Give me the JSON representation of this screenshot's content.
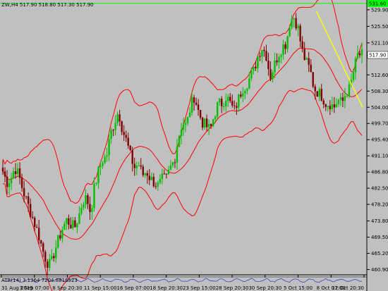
{
  "window": {
    "symbol_label": "ZW,H4",
    "ohlc": [
      "517.90",
      "518.80",
      "517.30",
      "517.90"
    ]
  },
  "indicator": {
    "label": "ATR(14) 3.1364  7204.8816523"
  },
  "colors": {
    "background": "#c0c0c0",
    "up_candle": "#00c000",
    "down_candle": "#800000",
    "bands": "#ff0000",
    "trendline": "#ffff00",
    "hline": "#00ff00",
    "grid": "#a9a9a9",
    "axis_text": "#000000"
  },
  "chart_data": {
    "type": "candlestick",
    "title": "ZW,H4",
    "y_ticks": [
      "529.90",
      "525.50",
      "521.10",
      "517.90",
      "512.60",
      "508.30",
      "504.00",
      "499.70",
      "495.40",
      "491.10",
      "486.80",
      "482.50",
      "478.20",
      "473.80",
      "469.50",
      "465.20",
      "460.90"
    ],
    "ylim": [
      459.5,
      532.5
    ],
    "x_ticks": [
      "31 Aug 2015",
      "3 Sep 07:00",
      "8 Sep 20:30",
      "11 Sep 15:00",
      "16 Sep 07:00",
      "18 Sep 20:30",
      "23 Sep 15:00",
      "28 Sep 20:30",
      "30 Sep 20:30",
      "5 Oct 15:00",
      "8 Oct 07:00",
      "12 Oct 20:30"
    ],
    "current_price": "517.90",
    "horizontal_line": {
      "value": 531.6,
      "label": "531.60"
    },
    "trendline": {
      "from": [
        "5 Oct 15:00",
        529.5
      ],
      "to": [
        "12 Oct 20:30",
        504.0
      ]
    },
    "bollinger": {
      "upper": "upper band",
      "middle": "middle band",
      "lower": "lower band"
    },
    "close_path": [
      487,
      484,
      485,
      488,
      486,
      482,
      479,
      476,
      473,
      470,
      466,
      463,
      462,
      466,
      469,
      472,
      474,
      473,
      472,
      475,
      479,
      480,
      476,
      483,
      487,
      490,
      491,
      497,
      500,
      503,
      498,
      495,
      491,
      488,
      489,
      486,
      487,
      485,
      484,
      483,
      485,
      485,
      488,
      490,
      496,
      500,
      499,
      504,
      507,
      503,
      500,
      499,
      498,
      502,
      505,
      505,
      507,
      505,
      503,
      506,
      509,
      510,
      512,
      514,
      518,
      520,
      518,
      512,
      515,
      518,
      520,
      521,
      527,
      528,
      525,
      519,
      516,
      514,
      509,
      508,
      507,
      505,
      505,
      504,
      506,
      505,
      508,
      509,
      514,
      518,
      517.9
    ]
  }
}
